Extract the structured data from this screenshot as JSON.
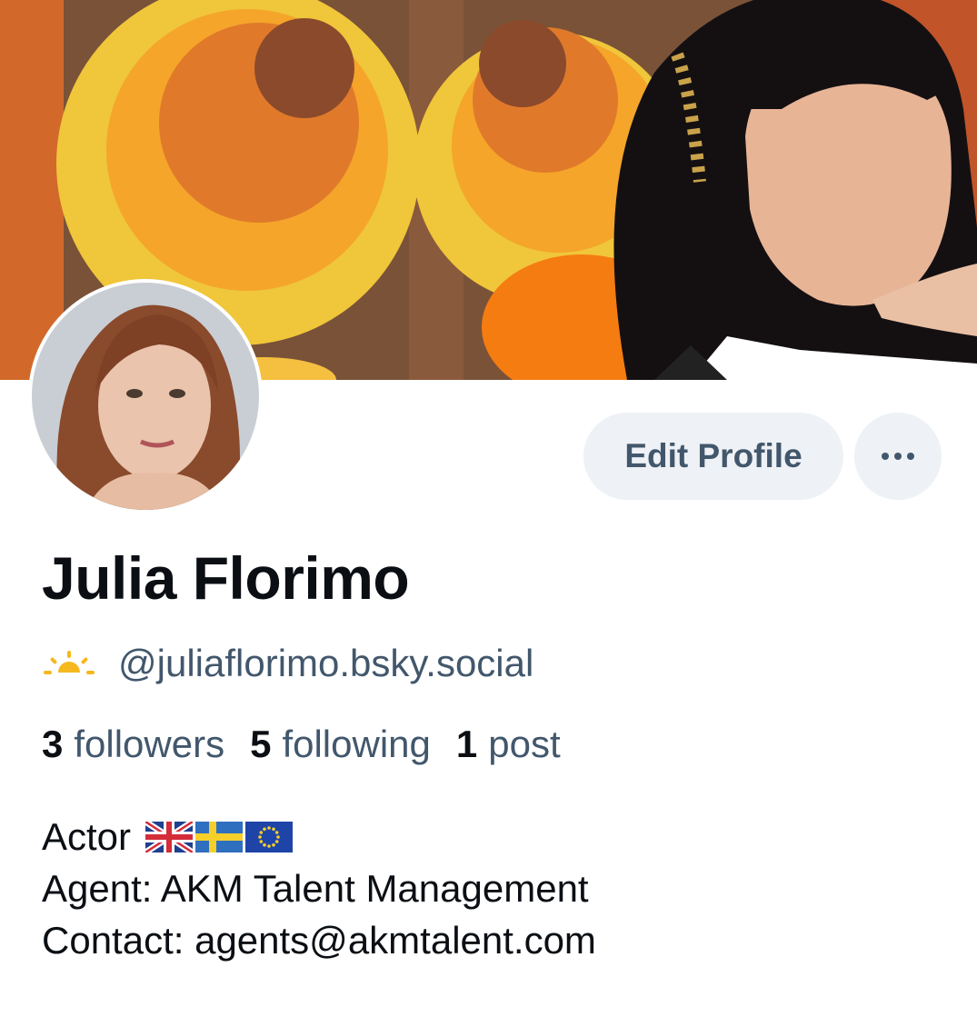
{
  "profile": {
    "display_name": "Julia Florimo",
    "handle": "@juliaflorimo.bsky.social",
    "handle_icon": "sun-icon",
    "banner_image": "retro-orange-circles-photo",
    "avatar_image": "portrait-photo"
  },
  "actions": {
    "edit_label": "Edit Profile",
    "more_icon": "ellipsis-icon"
  },
  "stats": [
    {
      "count": "3",
      "label": "followers"
    },
    {
      "count": "5",
      "label": "following"
    },
    {
      "count": "1",
      "label": "post"
    }
  ],
  "bio": {
    "line1": "Actor",
    "flags": [
      "uk-flag-icon",
      "sweden-flag-icon",
      "eu-flag-icon"
    ],
    "line2": "Agent: AKM Talent Management",
    "line3": "Contact: agents@akmtalent.com"
  },
  "colors": {
    "primary_text": "#0b0f14",
    "secondary_text": "#42576c",
    "button_bg": "#eef1f5",
    "accent_sun": "#f5b81e"
  }
}
